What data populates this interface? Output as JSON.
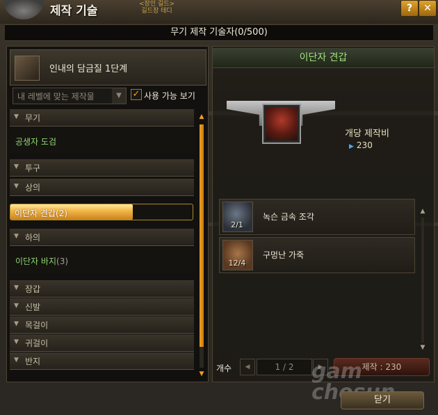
{
  "window": {
    "title": "제작 기술",
    "guild_line1": "<장인 길드>",
    "guild_line2": "길드장 테디",
    "help_icon": "question-icon",
    "close_icon": "close-icon"
  },
  "header": {
    "skill_level_text": "무기 제작 기술자(0/500)"
  },
  "left": {
    "skill_name": "인내의 담금질 1단계",
    "filter_placeholder": "내 레벨에 맞는 제작물",
    "show_available_label": "사용 가능 보기",
    "show_available_checked": true,
    "tree": [
      {
        "type": "category",
        "label": "무기"
      },
      {
        "type": "item",
        "label": "공생자 도검",
        "count": ""
      },
      {
        "type": "category",
        "label": "투구"
      },
      {
        "type": "category",
        "label": "상의"
      },
      {
        "type": "selected",
        "label": "이단자 견갑",
        "count": "(2)",
        "progress": 0.67
      },
      {
        "type": "category",
        "label": "하의"
      },
      {
        "type": "item",
        "label": "이단자 바지",
        "count": "(3)"
      },
      {
        "type": "category",
        "label": "장갑"
      },
      {
        "type": "category",
        "label": "신발"
      },
      {
        "type": "category",
        "label": "목걸이"
      },
      {
        "type": "category",
        "label": "귀걸이"
      },
      {
        "type": "category",
        "label": "반지"
      }
    ]
  },
  "right": {
    "item_title": "이단자 견갑",
    "cost_label": "개당 제작비",
    "cost_value": "230",
    "materials": [
      {
        "name": "녹슨 금속 조각",
        "qty": "2/1",
        "icon": "metal-scrap-icon"
      },
      {
        "name": "구멍난 가죽",
        "qty": "12/4",
        "icon": "leather-icon"
      }
    ],
    "count_label": "개수",
    "count_value": "1 / 2",
    "make_button": "제작 : 230",
    "close_button": "닫기",
    "watermark_1": "gam",
    "watermark_2": "chosun"
  },
  "colors": {
    "accent_orange": "#f0a020",
    "item_green": "#8fd470",
    "title_green": "#9fe07a"
  }
}
